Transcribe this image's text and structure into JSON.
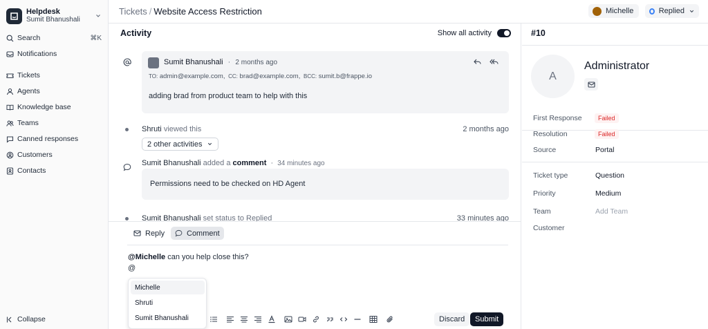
{
  "sidebar": {
    "brand_name": "Helpdesk",
    "brand_user": "Sumit Bhanushali",
    "search": "Search",
    "search_shortcut": "⌘K",
    "notifications": "Notifications",
    "items": [
      {
        "label": "Tickets",
        "icon": "ticket-icon"
      },
      {
        "label": "Agents",
        "icon": "user-icon"
      },
      {
        "label": "Knowledge base",
        "icon": "book-icon"
      },
      {
        "label": "Teams",
        "icon": "users-icon"
      },
      {
        "label": "Canned responses",
        "icon": "message-square-icon"
      },
      {
        "label": "Customers",
        "icon": "building-icon"
      },
      {
        "label": "Contacts",
        "icon": "contact-icon"
      }
    ],
    "collapse": "Collapse"
  },
  "header": {
    "breadcrumb_parent": "Tickets",
    "breadcrumb_separator": "/",
    "breadcrumb_current": "Website Access Restriction",
    "assignee": "Michelle",
    "status": "Replied"
  },
  "activity": {
    "title": "Activity",
    "show_all_label": "Show all activity",
    "email": {
      "sender": "Sumit Bhanushali",
      "dot": "·",
      "time": "2 months ago",
      "to_label": "TO:",
      "to": "admin@example.com,",
      "cc_label": "CC:",
      "cc": "brad@example.com,",
      "bcc_label": "BCC:",
      "bcc": "sumit.b@frappe.io",
      "body": "adding brad from product team to help with this"
    },
    "view": {
      "actor": "Shruti",
      "action": "viewed this",
      "time": "2 months ago"
    },
    "other_activities": "2 other activities",
    "comment": {
      "actor": "Sumit Bhanushali",
      "action": "added a",
      "kind": "comment",
      "dot": "·",
      "time": "34 minutes ago",
      "body": "Permissions need to be checked on HD Agent"
    },
    "status_change": {
      "actor": "Sumit Bhanushali",
      "action": "set status to Replied",
      "time": "33 minutes ago"
    }
  },
  "composer": {
    "reply_tab": "Reply",
    "comment_tab": "Comment",
    "line1_mention": "@Michelle",
    "line1_text": "can you help close this?",
    "line2": "@",
    "mentions": [
      "Michelle",
      "Shruti",
      "Sumit Bhanushali"
    ],
    "discard": "Discard",
    "submit": "Submit"
  },
  "panel": {
    "ticket_number": "#10",
    "avatar_initial": "A",
    "contact_name": "Administrator",
    "first_response_label": "First Response",
    "first_response_value": "Failed",
    "resolution_label": "Resolution",
    "resolution_value": "Failed",
    "source_label": "Source",
    "source_value": "Portal",
    "ticket_type_label": "Ticket type",
    "ticket_type_value": "Question",
    "priority_label": "Priority",
    "priority_value": "Medium",
    "team_label": "Team",
    "team_placeholder": "Add Team",
    "customer_label": "Customer"
  },
  "colors": {
    "accent": "#111827",
    "status_blue": "#3b82f6",
    "failed_red": "#dc2626"
  }
}
